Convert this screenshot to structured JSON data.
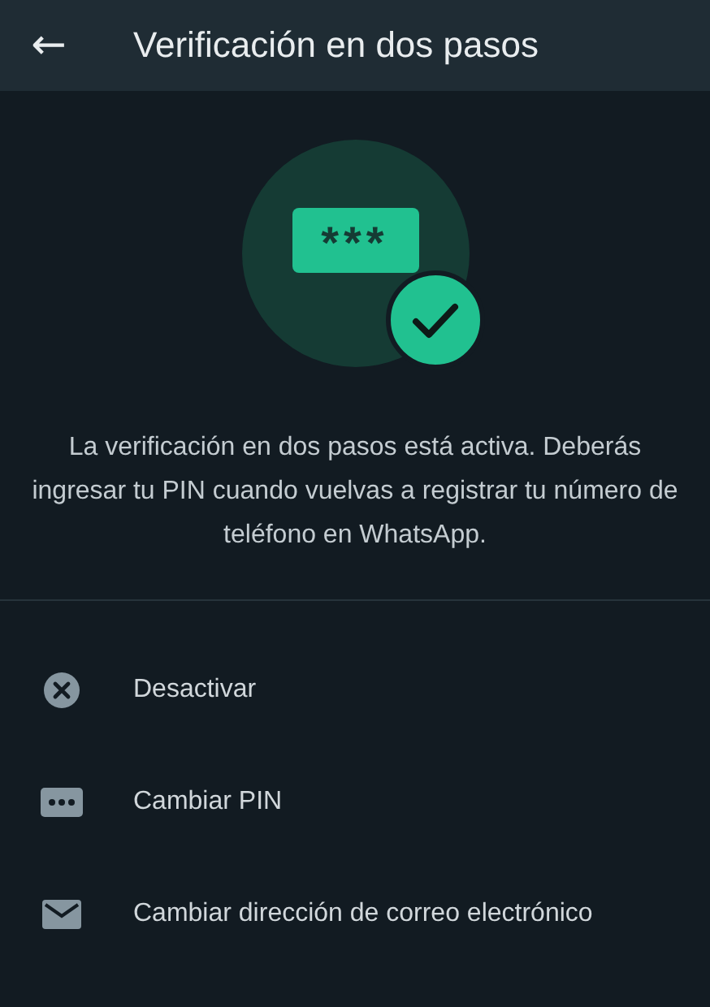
{
  "header": {
    "back": "←",
    "title": "Verificación en dos pasos"
  },
  "illustration": {
    "pin_mask": "***",
    "verified": true
  },
  "description": "La verificación en dos pasos está activa. Deberás ingresar tu PIN cuando vuelvas a registrar tu número de teléfono en WhatsApp.",
  "options": [
    {
      "kind": "disable",
      "label": "Desactivar"
    },
    {
      "kind": "pin",
      "label": "Cambiar PIN"
    },
    {
      "kind": "email",
      "label": "Cambiar dirección de correo electrónico"
    }
  ]
}
